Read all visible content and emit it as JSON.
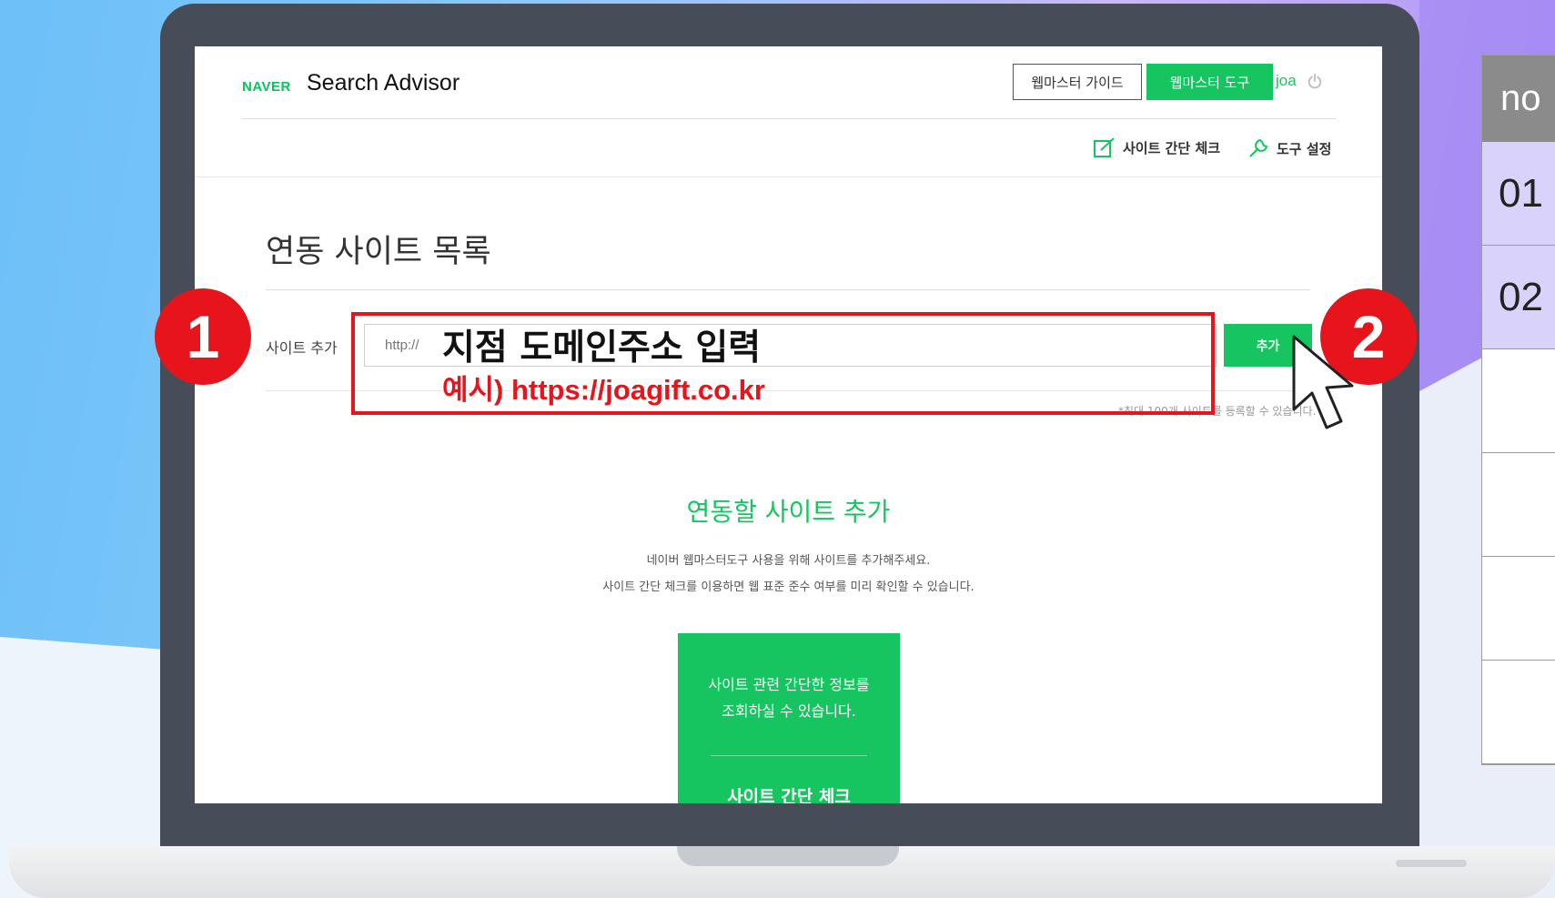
{
  "header": {
    "logo": "NAVER",
    "title": "Search Advisor",
    "guide_button": "웹마스터 가이드",
    "tools_button": "웹마스터 도구",
    "user": "joa"
  },
  "subnav": {
    "site_check": "사이트 간단 체크",
    "tool_settings": "도구 설정"
  },
  "main": {
    "page_title": "연동 사이트 목록",
    "site_add_label": "사이트 추가",
    "input_placeholder": "http://",
    "add_button": "추가",
    "limit_note": "*최대 100개 사이트를 등록할 수 있습니다.",
    "section_title": "연동할 사이트 추가",
    "desc_line1": "네이버 웹마스터도구 사용을 위해 사이트를 추가해주세요.",
    "desc_line2": "사이트 간단 체크를 이용하면 웹 표준 준수 여부를 미리 확인할 수 있습니다.",
    "card_text": "사이트 관련 간단한 정보를\n조회하실 수 있습니다.",
    "card_button": "사이트 간단 체크"
  },
  "annotations": {
    "instruction": "지점 도메인주소 입력",
    "example": "예시) https://joagift.co.kr",
    "step1": "1",
    "step2": "2"
  },
  "side_table": {
    "header": "no",
    "rows": [
      "01",
      "02",
      "",
      "",
      "",
      ""
    ]
  },
  "colors": {
    "naver_green": "#16c55f",
    "annotation_red": "#e8141b"
  }
}
